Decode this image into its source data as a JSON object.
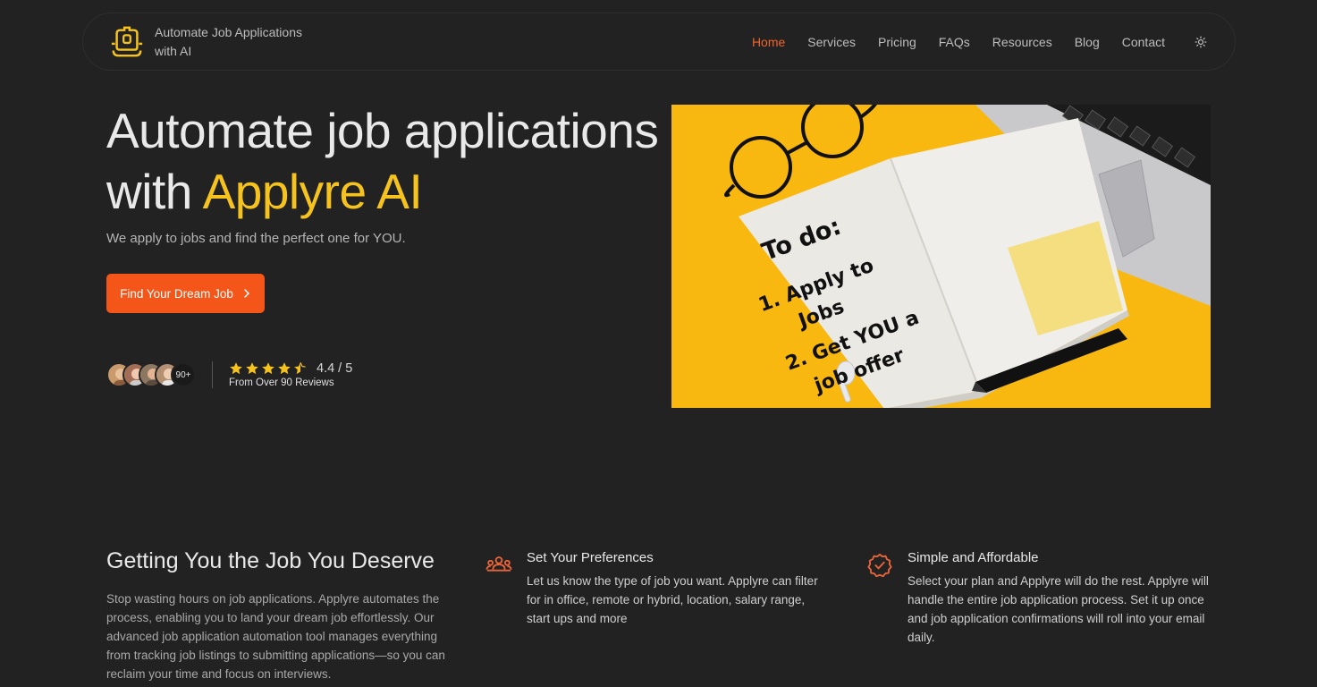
{
  "brand": {
    "name": "Automate Job Applications with AI",
    "logo_icon": "briefcase-logo-icon",
    "accent_color": "#f6c31e"
  },
  "nav": {
    "items": [
      {
        "label": "Home",
        "active": true
      },
      {
        "label": "Services"
      },
      {
        "label": "Pricing"
      },
      {
        "label": "FAQs"
      },
      {
        "label": "Resources"
      },
      {
        "label": "Blog"
      },
      {
        "label": "Contact"
      }
    ],
    "theme_toggle_icon": "sun-icon",
    "active_color": "#f0642c"
  },
  "hero": {
    "title_line1": "Automate job applications",
    "title_with": "with ",
    "title_accent": "Applyre AI",
    "subtitle": "We apply to jobs and find the perfect one for YOU.",
    "cta_label": "Find Your Dream Job",
    "cta_color": "#f4561a",
    "avatar_count": "90+",
    "rating": "4.4 / 5",
    "rating_stars": 4.5,
    "rating_note": "From Over 90 Reviews",
    "image": {
      "heading": "To do:",
      "line1": "1. Apply to",
      "line2": "Jobs",
      "line3": "2. Get YOU a",
      "line4": "job offer"
    }
  },
  "features": {
    "title": "Getting You the Job You Deserve",
    "description": "Stop wasting hours on job applications. Applyre automates the process, enabling you to land your dream job effortlessly. Our advanced job application automation tool manages everything from tracking job listings to submitting applications—so you can reclaim your time and focus on interviews.",
    "items": [
      {
        "icon": "people-icon",
        "title": "Set Your Preferences",
        "text": "Let us know the type of job you want. Applyre can filter for in office, remote or hybrid, location, salary range, start ups and more"
      },
      {
        "icon": "verified-badge-icon",
        "title": "Simple and Affordable",
        "text": "Select your plan and Applyre will do the rest. Applyre will handle the entire job application process. Set it up once and job application confirmations will roll into your email daily."
      }
    ]
  }
}
